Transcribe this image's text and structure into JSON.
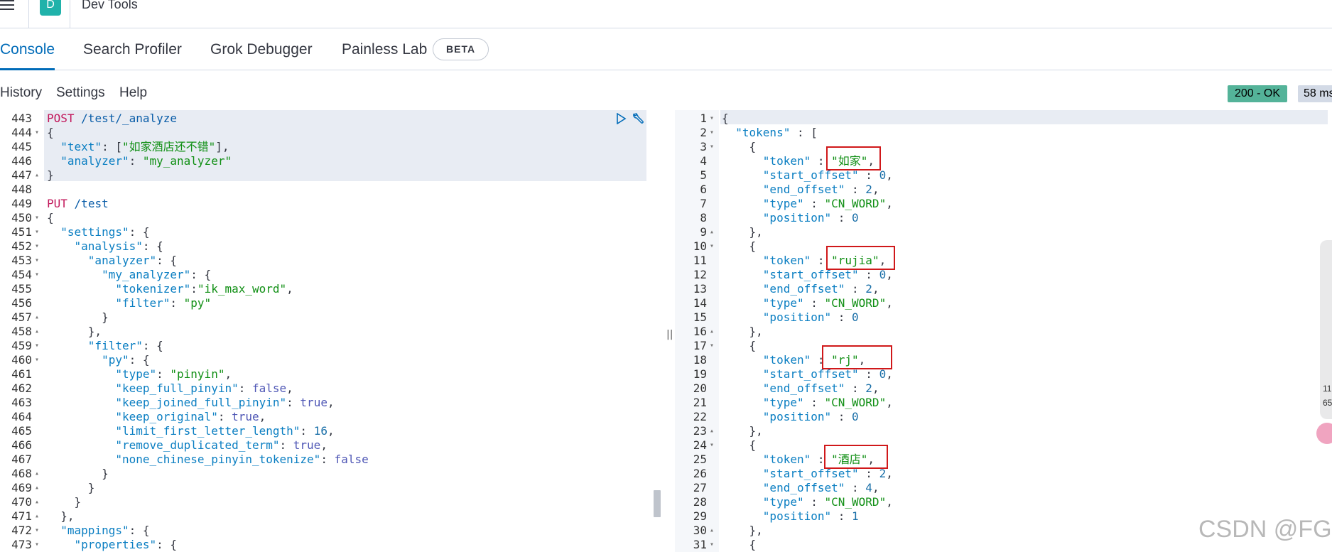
{
  "header": {
    "app_badge": "D",
    "app_title": "Dev Tools"
  },
  "tabs": [
    {
      "label": "Console",
      "active": true
    },
    {
      "label": "Search Profiler",
      "active": false
    },
    {
      "label": "Grok Debugger",
      "active": false
    },
    {
      "label": "Painless Lab",
      "active": false
    }
  ],
  "beta_badge": "BETA",
  "menu": {
    "history": "History",
    "settings": "Settings",
    "help": "Help"
  },
  "response_status": {
    "status": "200 - OK",
    "time": "58 ms"
  },
  "request_editor": {
    "line_numbers": [
      "443",
      "444",
      "445",
      "446",
      "447",
      "448",
      "449",
      "450",
      "451",
      "452",
      "453",
      "454",
      "455",
      "456",
      "457",
      "458",
      "459",
      "460",
      "461",
      "462",
      "463",
      "464",
      "465",
      "466",
      "467",
      "468",
      "469",
      "470",
      "471",
      "472",
      "473"
    ],
    "lines": [
      "POST /test/_analyze",
      "{",
      "  \"text\": [\"如家酒店还不错\"],",
      "  \"analyzer\": \"my_analyzer\"",
      "}",
      "",
      "PUT /test",
      "{",
      "  \"settings\": {",
      "    \"analysis\": {",
      "      \"analyzer\": {",
      "        \"my_analyzer\": {",
      "          \"tokenizer\":\"ik_max_word\",",
      "          \"filter\": \"py\"",
      "        }",
      "      },",
      "      \"filter\": {",
      "        \"py\": {",
      "          \"type\": \"pinyin\",",
      "          \"keep_full_pinyin\": false,",
      "          \"keep_joined_full_pinyin\": true,",
      "          \"keep_original\": true,",
      "          \"limit_first_letter_length\": 16,",
      "          \"remove_duplicated_term\": true,",
      "          \"none_chinese_pinyin_tokenize\": false",
      "        }",
      "      }",
      "    }",
      "  },",
      "  \"mappings\": {",
      "    \"properties\": {"
    ]
  },
  "response_editor": {
    "line_numbers": [
      "1",
      "2",
      "3",
      "4",
      "5",
      "6",
      "7",
      "8",
      "9",
      "10",
      "11",
      "12",
      "13",
      "14",
      "15",
      "16",
      "17",
      "18",
      "19",
      "20",
      "21",
      "22",
      "23",
      "24",
      "25",
      "26",
      "27",
      "28",
      "29",
      "30",
      "31"
    ],
    "lines": [
      "{",
      "  \"tokens\" : [",
      "    {",
      "      \"token\" : \"如家\",",
      "      \"start_offset\" : 0,",
      "      \"end_offset\" : 2,",
      "      \"type\" : \"CN_WORD\",",
      "      \"position\" : 0",
      "    },",
      "    {",
      "      \"token\" : \"rujia\",",
      "      \"start_offset\" : 0,",
      "      \"end_offset\" : 2,",
      "      \"type\" : \"CN_WORD\",",
      "      \"position\" : 0",
      "    },",
      "    {",
      "      \"token\" : \"rj\",",
      "      \"start_offset\" : 0,",
      "      \"end_offset\" : 2,",
      "      \"type\" : \"CN_WORD\",",
      "      \"position\" : 0",
      "    },",
      "    {",
      "      \"token\" : \"酒店\",",
      "      \"start_offset\" : 2,",
      "      \"end_offset\" : 4,",
      "      \"type\" : \"CN_WORD\",",
      "      \"position\" : 1",
      "    },",
      "    {"
    ]
  },
  "side_widget": [
    "11",
    "65"
  ],
  "watermark": "CSDN @FG."
}
